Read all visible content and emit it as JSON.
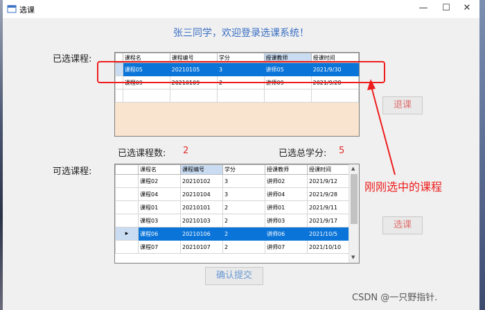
{
  "window": {
    "title": "选课",
    "minimize": "—",
    "maximize": "☐",
    "close": "✕"
  },
  "greeting": "张三同学，欢迎登录选课系统！",
  "selected": {
    "label": "已选课程:",
    "columns": [
      "课程名",
      "课程编号",
      "学分",
      "授课教师",
      "授课时间"
    ],
    "rows": [
      [
        "课程05",
        "20210105",
        "3",
        "讲师05",
        "2021/9/30"
      ],
      [
        "课程09",
        "20210109",
        "2",
        "讲师09",
        "2021/9/28"
      ]
    ],
    "count_label": "已选课程数:",
    "count_value": "2",
    "credits_label": "已选总学分:",
    "credits_value": "5"
  },
  "available": {
    "label": "可选课程:",
    "columns": [
      "课程名",
      "课程编号",
      "学分",
      "授课教师",
      "授课时间"
    ],
    "rows": [
      [
        "课程02",
        "20210102",
        "3",
        "讲师02",
        "2021/9/12"
      ],
      [
        "课程04",
        "20210104",
        "3",
        "讲师04",
        "2021/9/28"
      ],
      [
        "课程01",
        "20210101",
        "2",
        "讲师01",
        "2021/9/11"
      ],
      [
        "课程03",
        "20210103",
        "2",
        "讲师03",
        "2021/9/17"
      ],
      [
        "课程06",
        "20210106",
        "2",
        "讲师06",
        "2021/10/5"
      ],
      [
        "课程07",
        "20210107",
        "2",
        "讲师07",
        "2021/10/10"
      ]
    ],
    "current_row_marker": "▸"
  },
  "buttons": {
    "drop": "退课",
    "choose": "选课",
    "submit": "确认提交"
  },
  "annotation": "刚刚选中的课程",
  "watermark": "CSDN @一只野指针.",
  "colors": {
    "accent": "#0a74d8",
    "annotation": "#ee1c1c",
    "greeting": "#3a6fc4"
  }
}
